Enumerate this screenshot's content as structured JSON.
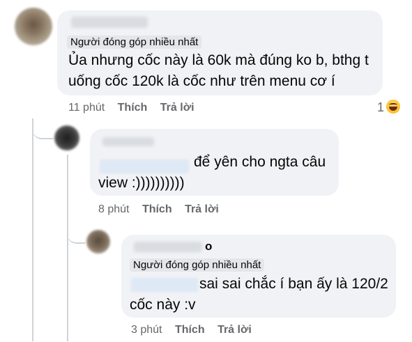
{
  "comment1": {
    "badge": "Người đóng góp nhiều nhất",
    "text_line1": "Ủa nhưng cốc này là 60k mà đúng ko b, bthg t",
    "text_line2": "uống cốc 120k là cốc như trên menu cơ í",
    "time": "11 phút",
    "like": "Thích",
    "reply": "Trả lời",
    "reaction_count": "1",
    "reaction_icon": "haha-icon"
  },
  "comment2": {
    "text_line1": "để yên cho ngta câu",
    "text_line2": "view :))))))))))",
    "time": "8 phút",
    "like": "Thích",
    "reply": "Trả lời"
  },
  "comment3": {
    "name_suffix": "o",
    "badge": "Người đóng góp nhiều nhất",
    "text_line1": "sai sai chắc í bạn ấy là 120/2",
    "text_line2": "cốc này :v",
    "time": "3 phút",
    "like": "Thích",
    "reply": "Trả lời"
  },
  "colors": {
    "bubble": "#f0f2f5",
    "meta_text": "#65676b",
    "thread_line": "#cfd3d8"
  }
}
